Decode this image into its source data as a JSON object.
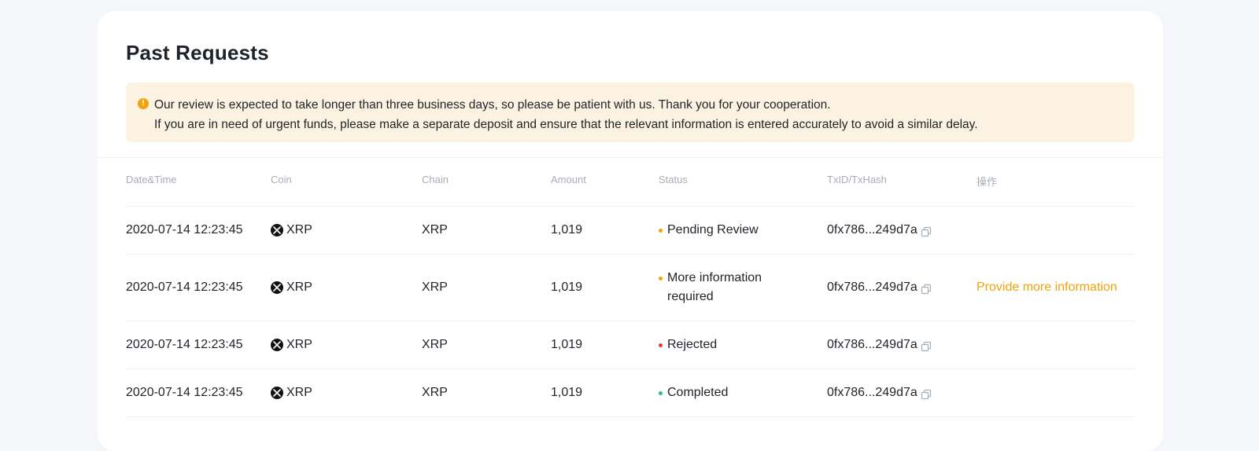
{
  "page": {
    "title": "Past Requests"
  },
  "notice": {
    "icon": "warning-icon",
    "line1": "Our review is expected to take longer than three business days, so please be patient with us. Thank you for your cooperation.",
    "line2": "If you are in need of urgent funds, please make a separate deposit and ensure that the relevant information is entered accurately to avoid a similar delay."
  },
  "table": {
    "headers": {
      "date": "Date&Time",
      "coin": "Coin",
      "chain": "Chain",
      "amount": "Amount",
      "status": "Status",
      "txid": "TxID/TxHash",
      "action": "操作"
    },
    "rows": [
      {
        "date": "2020-07-14 12:23:45",
        "coin": "XRP",
        "chain": "XRP",
        "amount": "1,019",
        "status": "Pending Review",
        "status_color": "#f0a30a",
        "txid": "0fx786...249d7a",
        "action": ""
      },
      {
        "date": "2020-07-14 12:23:45",
        "coin": "XRP",
        "chain": "XRP",
        "amount": "1,019",
        "status": "More information required",
        "status_color": "#f0a30a",
        "txid": "0fx786...249d7a",
        "action": "Provide more information"
      },
      {
        "date": "2020-07-14 12:23:45",
        "coin": "XRP",
        "chain": "XRP",
        "amount": "1,019",
        "status": "Rejected",
        "status_color": "#e5393b",
        "txid": "0fx786...249d7a",
        "action": ""
      },
      {
        "date": "2020-07-14 12:23:45",
        "coin": "XRP",
        "chain": "XRP",
        "amount": "1,019",
        "status": "Completed",
        "status_color": "#2ebd85",
        "txid": "0fx786...249d7a",
        "action": ""
      }
    ]
  },
  "colors": {
    "accent": "#f0a30a",
    "notice_bg": "#fcf2e1",
    "header_text": "#a7adb6"
  }
}
